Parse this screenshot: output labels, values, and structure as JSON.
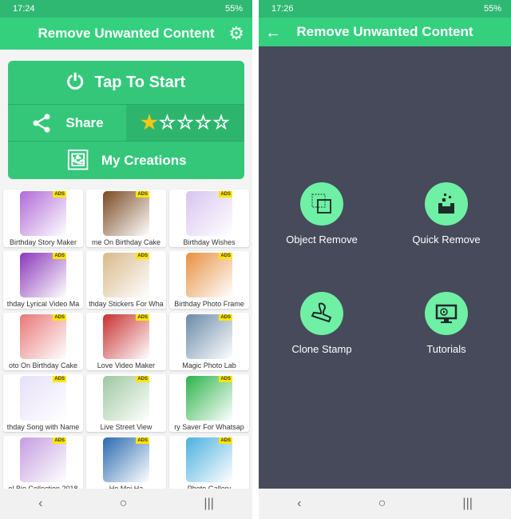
{
  "left": {
    "status": {
      "time": "17:24",
      "battery": "55%"
    },
    "title": "Remove Unwanted Content",
    "tap_to_start": "Tap To Start",
    "share": "Share",
    "rating": 1,
    "rating_max": 5,
    "my_creations": "My Creations",
    "ads_label": "ADS",
    "apps": [
      {
        "name": "Birthday Story Maker",
        "color": "#b06ad8"
      },
      {
        "name": "me On Birthday Cake",
        "color": "#7a4a22"
      },
      {
        "name": "Birthday Wishes",
        "color": "#d8c4f0"
      },
      {
        "name": "thday Lyrical Video Ma",
        "color": "#8a38b8"
      },
      {
        "name": "thday Stickers For Wha",
        "color": "#d9b98a"
      },
      {
        "name": "Birthday Photo Frame",
        "color": "#e89040"
      },
      {
        "name": "oto On Birthday Cake",
        "color": "#e87878"
      },
      {
        "name": "Love Video Maker",
        "color": "#c83030"
      },
      {
        "name": "Magic Photo Lab",
        "color": "#6a8aa8"
      },
      {
        "name": "thday Song with Name",
        "color": "#e6e0f8"
      },
      {
        "name": "Live Street View",
        "color": "#9ec8a0"
      },
      {
        "name": "ry Saver For Whatsap",
        "color": "#2bb34a"
      },
      {
        "name": "ol Bio Collection 2018",
        "color": "#c49ee0"
      },
      {
        "name": "Ho Moj Ha",
        "color": "#2a6ab0"
      },
      {
        "name": "Photo Gallery",
        "color": "#4ab0e0"
      }
    ]
  },
  "right": {
    "status": {
      "time": "17:26",
      "battery": "55%"
    },
    "title": "Remove Unwanted Content",
    "features": [
      {
        "label": "Object Remove",
        "icon": "overlapping-squares-icon"
      },
      {
        "label": "Quick Remove",
        "icon": "eraser-bucket-icon"
      },
      {
        "label": "Clone Stamp",
        "icon": "stamp-icon"
      },
      {
        "label": "Tutorials",
        "icon": "monitor-video-icon"
      }
    ]
  },
  "nav": {
    "back": "‹",
    "home": "○",
    "recents": "|||"
  },
  "colors": {
    "accent": "#34d07e",
    "dark_bg": "#464a5a",
    "circle": "#6ff0a4"
  }
}
